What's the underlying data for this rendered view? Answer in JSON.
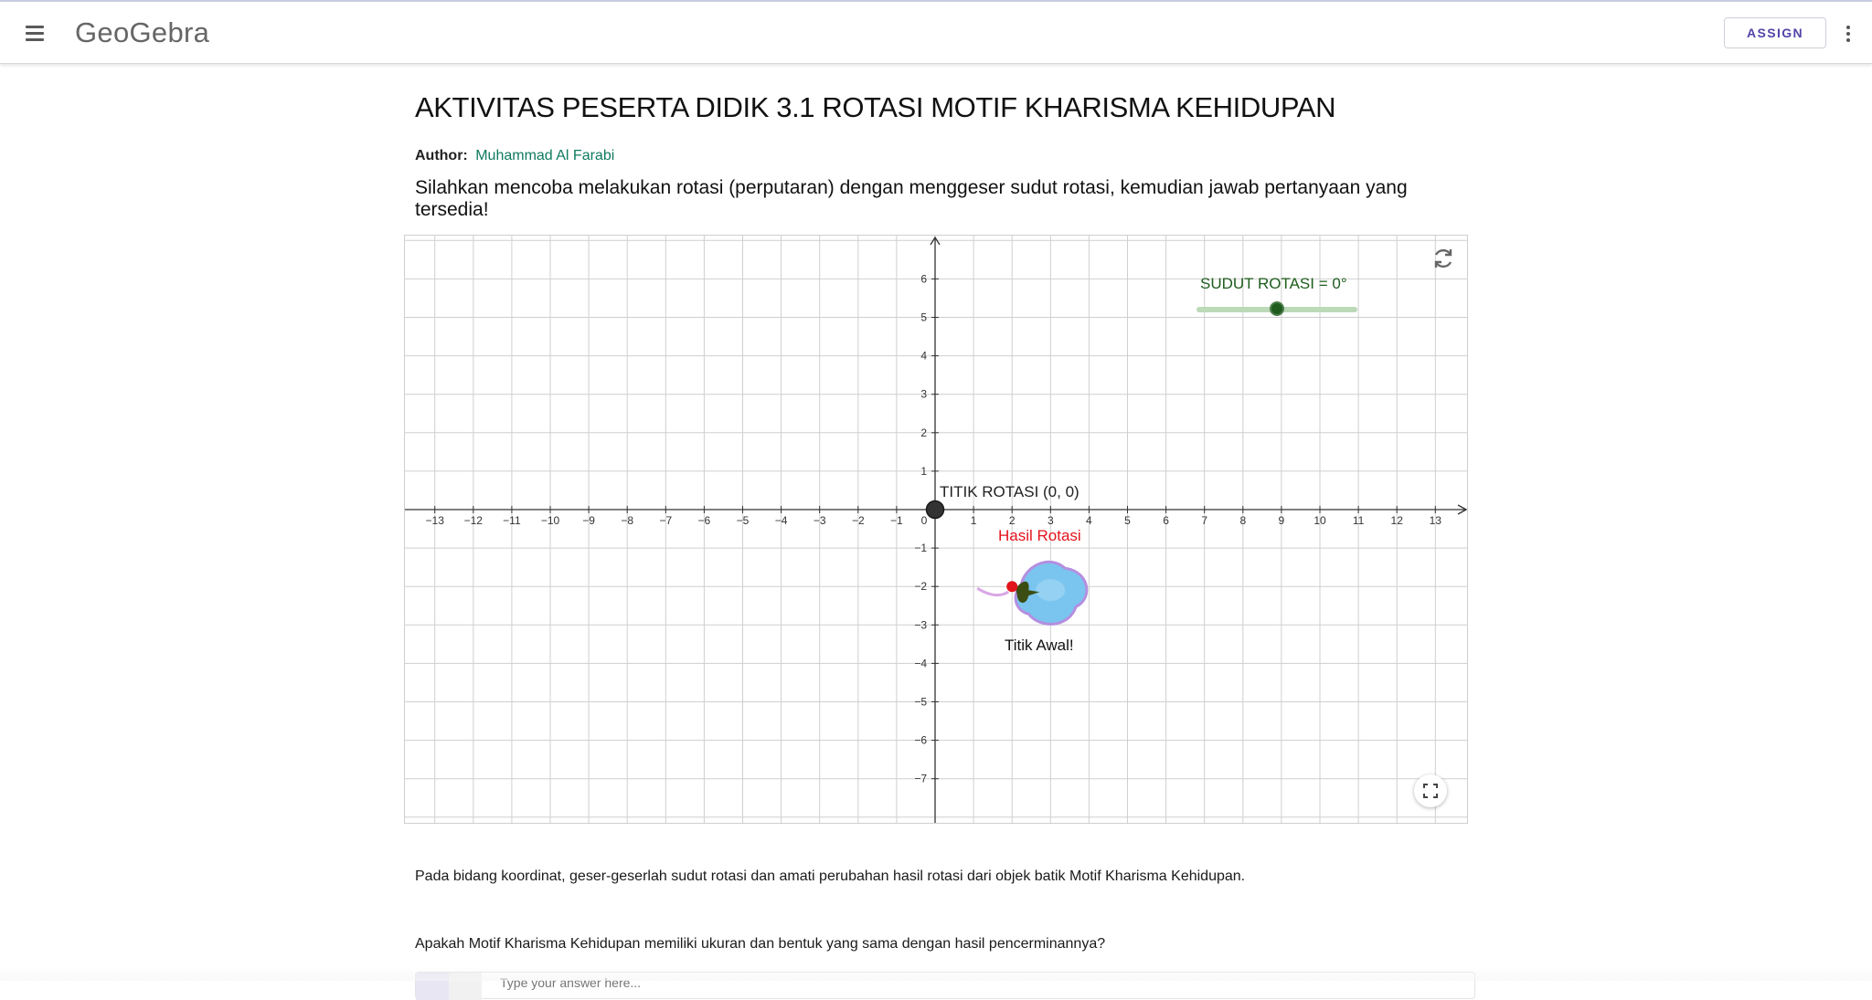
{
  "header": {
    "brand": "GeoGebra",
    "assign_label": "ASSIGN"
  },
  "page": {
    "title": "AKTIVITAS PESERTA DIDIK 3.1 ROTASI MOTIF KHARISMA KEHIDUPAN",
    "author_label": "Author:",
    "author_name": "Muhammad Al Farabi",
    "instruction": "Silahkan mencoba melakukan rotasi (perputaran) dengan menggeser sudut rotasi, kemudian jawab pertanyaan yang tersedia!",
    "paragraph": "Pada bidang koordinat, geser-geserlah sudut rotasi dan amati perubahan hasil rotasi dari objek batik Motif Kharisma Kehidupan.",
    "question": "Apakah Motif Kharisma Kehidupan memiliki ukuran dan bentuk yang sama dengan hasil pencerminannya?",
    "answer_placeholder": "Type your answer here..."
  },
  "applet": {
    "slider_label": "SUDUT ROTASI = 0°",
    "slider_value_deg": 0,
    "center_label": "TITIK ROTASI (0, 0)",
    "result_label": "Hasil Rotasi",
    "start_label": "Titik Awal!",
    "x_range": [
      -13,
      13
    ],
    "y_range": [
      -7,
      6
    ],
    "x_ticks": [
      "−13",
      "−12",
      "−11",
      "−10",
      "−9",
      "−8",
      "−7",
      "−6",
      "−5",
      "−4",
      "−3",
      "−2",
      "−1",
      "0",
      "1",
      "2",
      "3",
      "4",
      "5",
      "6",
      "7",
      "8",
      "9",
      "10",
      "11",
      "12",
      "13"
    ],
    "y_ticks": [
      "6",
      "5",
      "4",
      "3",
      "2",
      "1",
      "−1",
      "−2",
      "−3",
      "−4",
      "−5",
      "−6",
      "−7"
    ],
    "rotation_center": [
      0,
      0
    ],
    "start_point": [
      2,
      -2
    ],
    "colors": {
      "slider": "#1e5c1e",
      "result": "#e3141c",
      "grid": "#cfcfcf",
      "motif_main": "#79c5ef",
      "motif_edge": "#b48fe0",
      "motif_leaf": "#3b4d12"
    }
  },
  "icons": {
    "menu": "hamburger-menu-icon",
    "more": "more-vert-icon",
    "reset": "reset-icon",
    "fullscreen": "fullscreen-icon"
  }
}
